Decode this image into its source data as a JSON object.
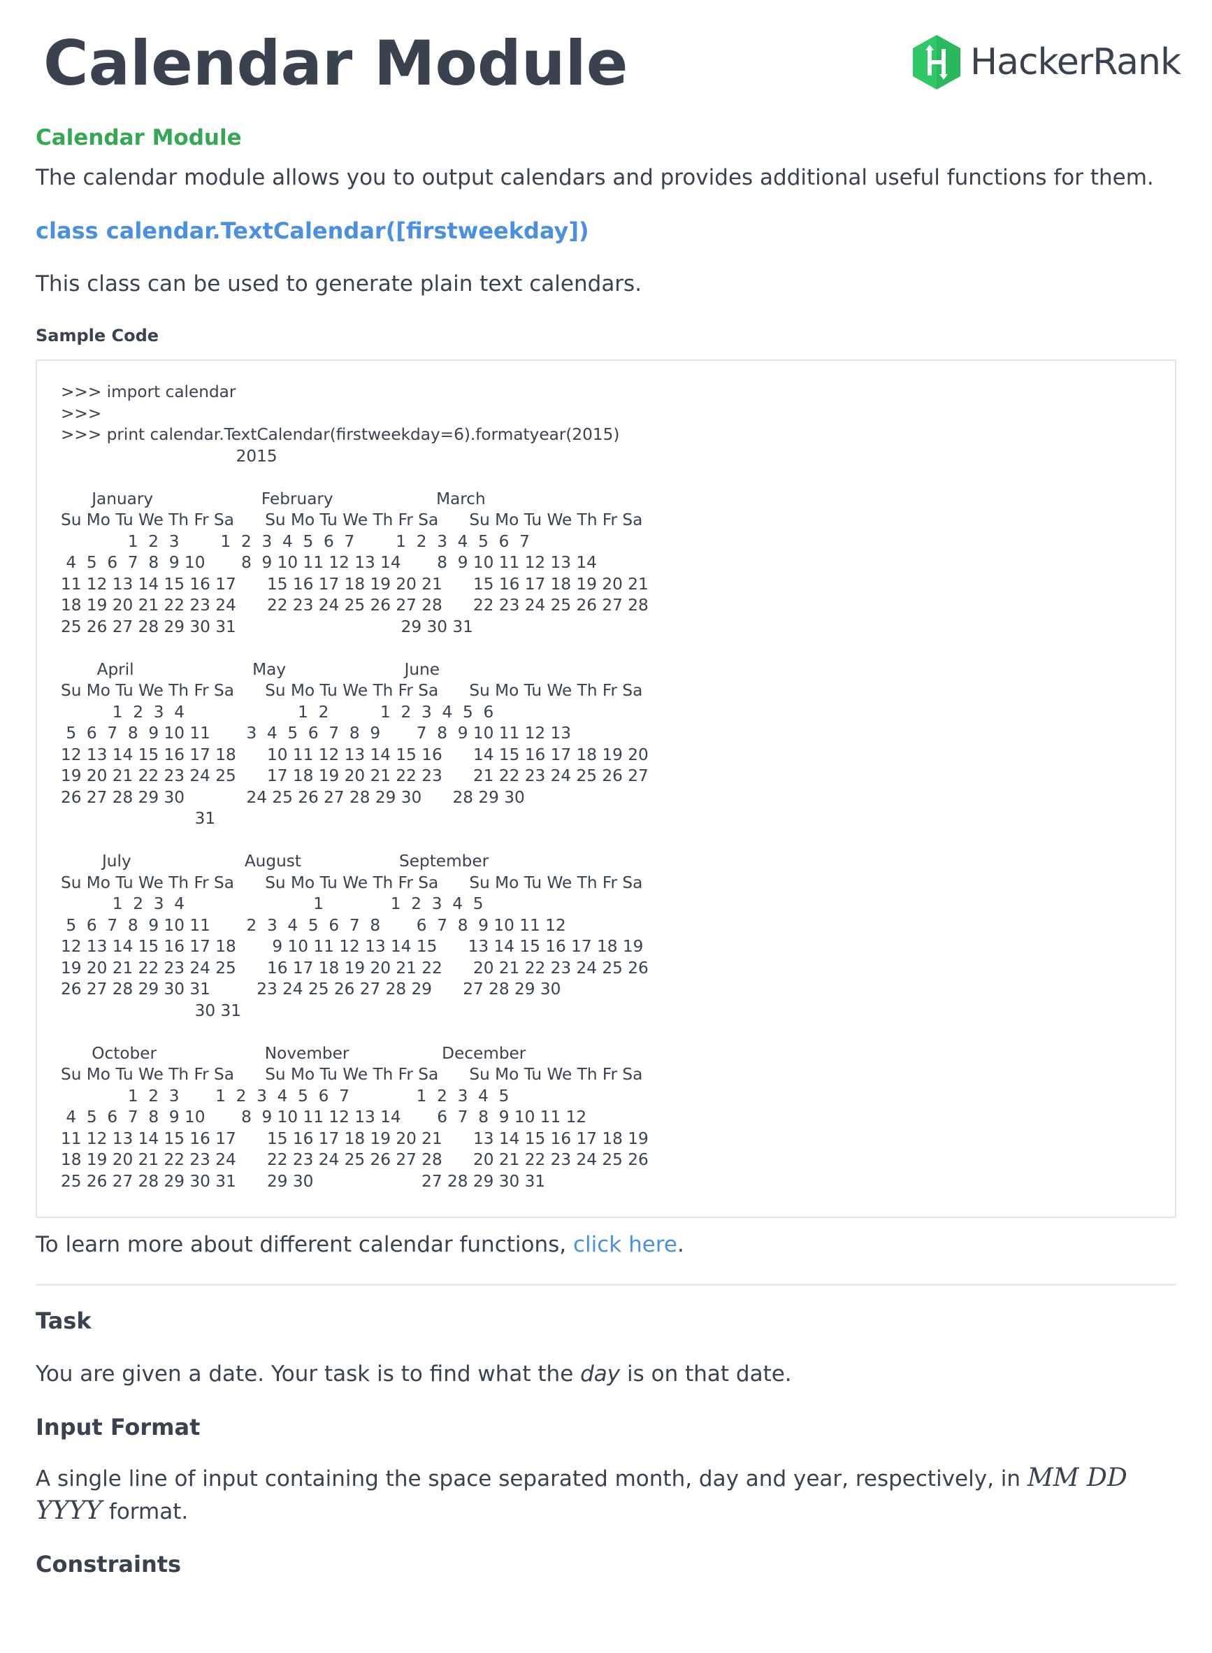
{
  "header": {
    "title": "Calendar Module",
    "logo_text": "HackerRank",
    "brand_color": "#2ec866"
  },
  "intro": {
    "heading": "Calendar Module",
    "description": "The calendar module allows you to output calendars and provides additional useful functions for them."
  },
  "textcalendar": {
    "class_signature": "class calendar.TextCalendar([firstweekday])",
    "description": "This class can be used to generate plain text calendars.",
    "sample_code_label": "Sample Code",
    "code": ">>> import calendar\n>>>\n>>> print calendar.TextCalendar(firstweekday=6).formatyear(2015)\n                                  2015\n\n      January                     February                    March\nSu Mo Tu We Th Fr Sa      Su Mo Tu We Th Fr Sa      Su Mo Tu We Th Fr Sa\n             1  2  3        1  2  3  4  5  6  7        1  2  3  4  5  6  7\n 4  5  6  7  8  9 10       8  9 10 11 12 13 14       8  9 10 11 12 13 14\n11 12 13 14 15 16 17      15 16 17 18 19 20 21      15 16 17 18 19 20 21\n18 19 20 21 22 23 24      22 23 24 25 26 27 28      22 23 24 25 26 27 28\n25 26 27 28 29 30 31                                29 30 31\n\n       April                       May                       June\nSu Mo Tu We Th Fr Sa      Su Mo Tu We Th Fr Sa      Su Mo Tu We Th Fr Sa\n          1  2  3  4                      1  2          1  2  3  4  5  6\n 5  6  7  8  9 10 11       3  4  5  6  7  8  9       7  8  9 10 11 12 13\n12 13 14 15 16 17 18      10 11 12 13 14 15 16      14 15 16 17 18 19 20\n19 20 21 22 23 24 25      17 18 19 20 21 22 23      21 22 23 24 25 26 27\n26 27 28 29 30            24 25 26 27 28 29 30      28 29 30\n                          31\n\n        July                      August                   September\nSu Mo Tu We Th Fr Sa      Su Mo Tu We Th Fr Sa      Su Mo Tu We Th Fr Sa\n          1  2  3  4                         1             1  2  3  4  5\n 5  6  7  8  9 10 11       2  3  4  5  6  7  8       6  7  8  9 10 11 12\n12 13 14 15 16 17 18       9 10 11 12 13 14 15      13 14 15 16 17 18 19\n19 20 21 22 23 24 25      16 17 18 19 20 21 22      20 21 22 23 24 25 26\n26 27 28 29 30 31         23 24 25 26 27 28 29      27 28 29 30\n                          30 31\n\n      October                     November                  December\nSu Mo Tu We Th Fr Sa      Su Mo Tu We Th Fr Sa      Su Mo Tu We Th Fr Sa\n             1  2  3       1  2  3  4  5  6  7             1  2  3  4  5\n 4  5  6  7  8  9 10       8  9 10 11 12 13 14       6  7  8  9 10 11 12\n11 12 13 14 15 16 17      15 16 17 18 19 20 21      13 14 15 16 17 18 19\n18 19 20 21 22 23 24      22 23 24 25 26 27 28      20 21 22 23 24 25 26\n25 26 27 28 29 30 31      29 30                     27 28 29 30 31",
    "learn_more_prefix": "To learn more about different calendar functions, ",
    "learn_more_link": "click here",
    "learn_more_suffix": "."
  },
  "task": {
    "heading": "Task",
    "text_before": "You are given a date. Your task is to find what the ",
    "text_emphasis": "day",
    "text_after": " is on that date."
  },
  "input_format": {
    "heading": "Input Format",
    "text_before": "A single line of input containing the space separated month, day and year, respectively, in ",
    "math_1": "MM DD",
    "math_2": "YYYY",
    "text_after": " format."
  },
  "constraints": {
    "heading": "Constraints"
  }
}
